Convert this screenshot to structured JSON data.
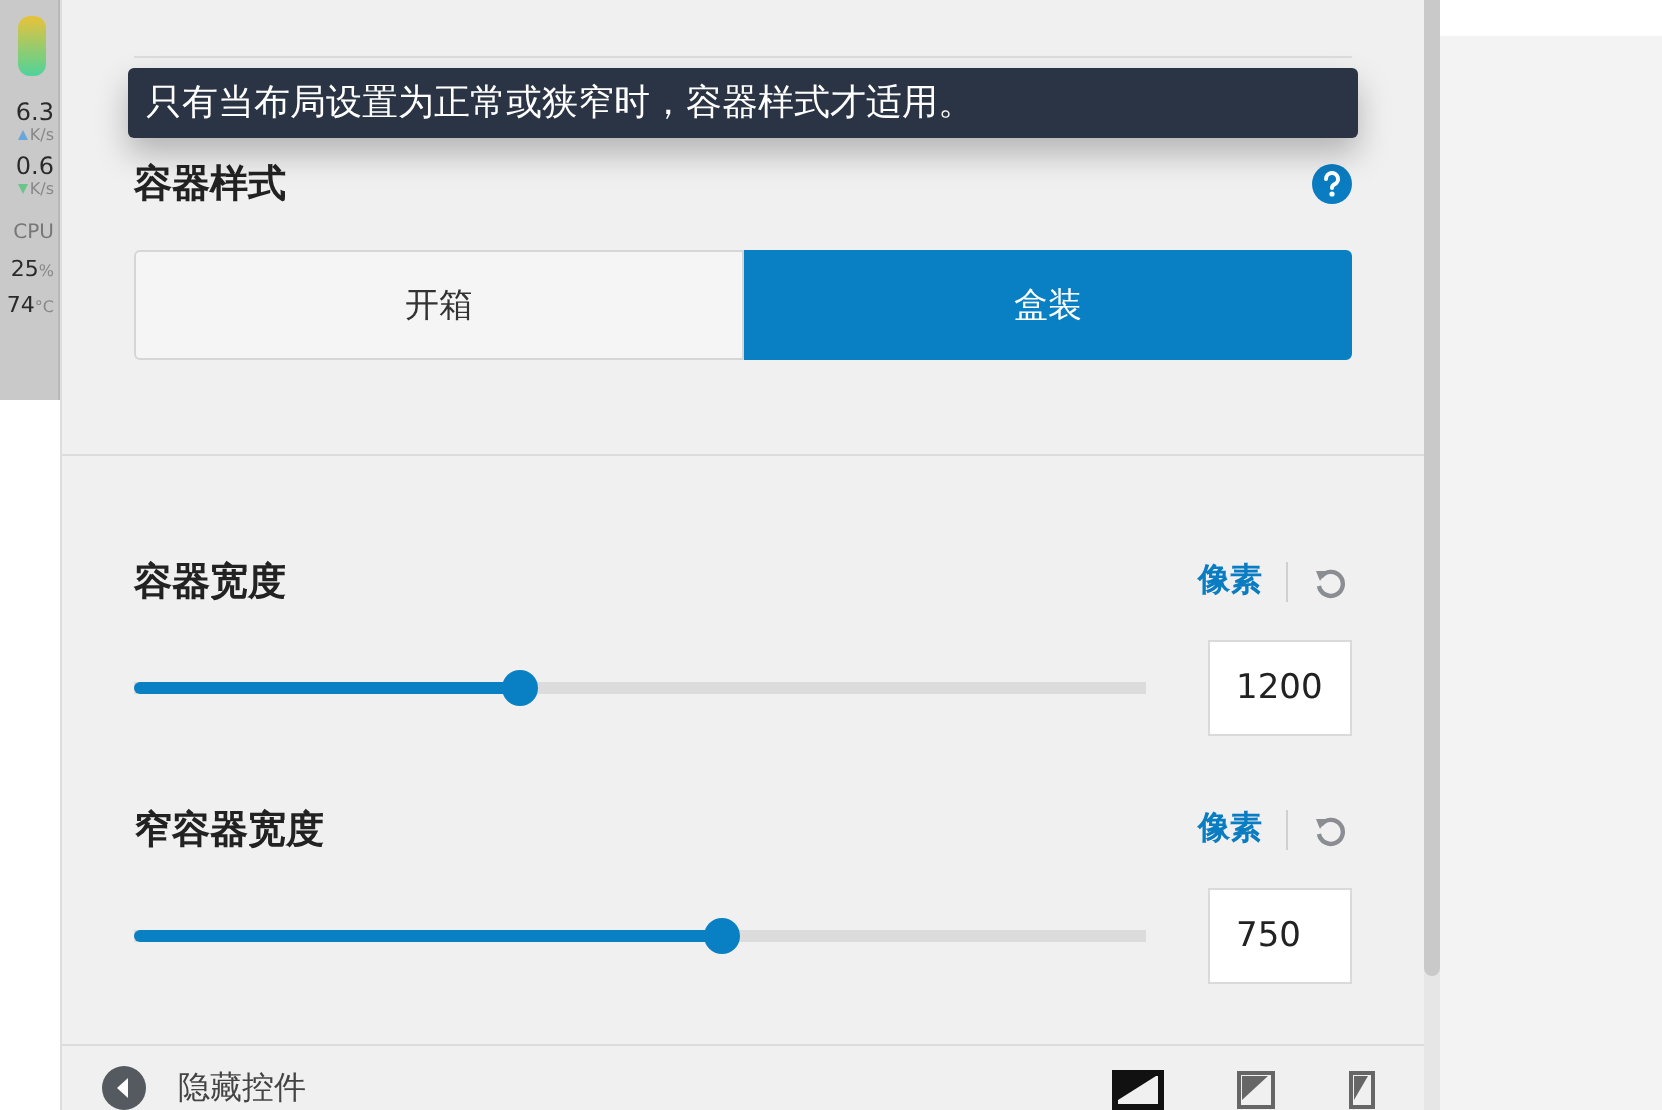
{
  "monitor": {
    "rows": [
      {
        "value": "6.3",
        "unit": "K/s",
        "kind": "up"
      },
      {
        "value": "0.6",
        "unit": "K/s",
        "kind": "down"
      },
      {
        "value": "CPU",
        "unit": "",
        "kind": "label"
      },
      {
        "value": "25",
        "unit": "%",
        "kind": "stat"
      },
      {
        "value": "74",
        "unit": "°C",
        "kind": "stat"
      }
    ]
  },
  "tooltip": "只有当布局设置为正常或狭窄时，容器样式才适用。",
  "container_style": {
    "title": "容器样式",
    "options": [
      {
        "label": "开箱",
        "selected": false
      },
      {
        "label": "盒装",
        "selected": true
      }
    ]
  },
  "sliders": [
    {
      "title": "容器宽度",
      "unit": "像素",
      "level": 0.377,
      "value": "1200"
    },
    {
      "title": "窄容器宽度",
      "unit": "像素",
      "level": 0.585,
      "value": "750"
    }
  ],
  "footer": {
    "label": "隐藏控件",
    "devices": [
      {
        "kind": "desktop",
        "selected": true
      },
      {
        "kind": "tablet",
        "selected": false
      },
      {
        "kind": "mobile",
        "selected": false
      }
    ]
  }
}
